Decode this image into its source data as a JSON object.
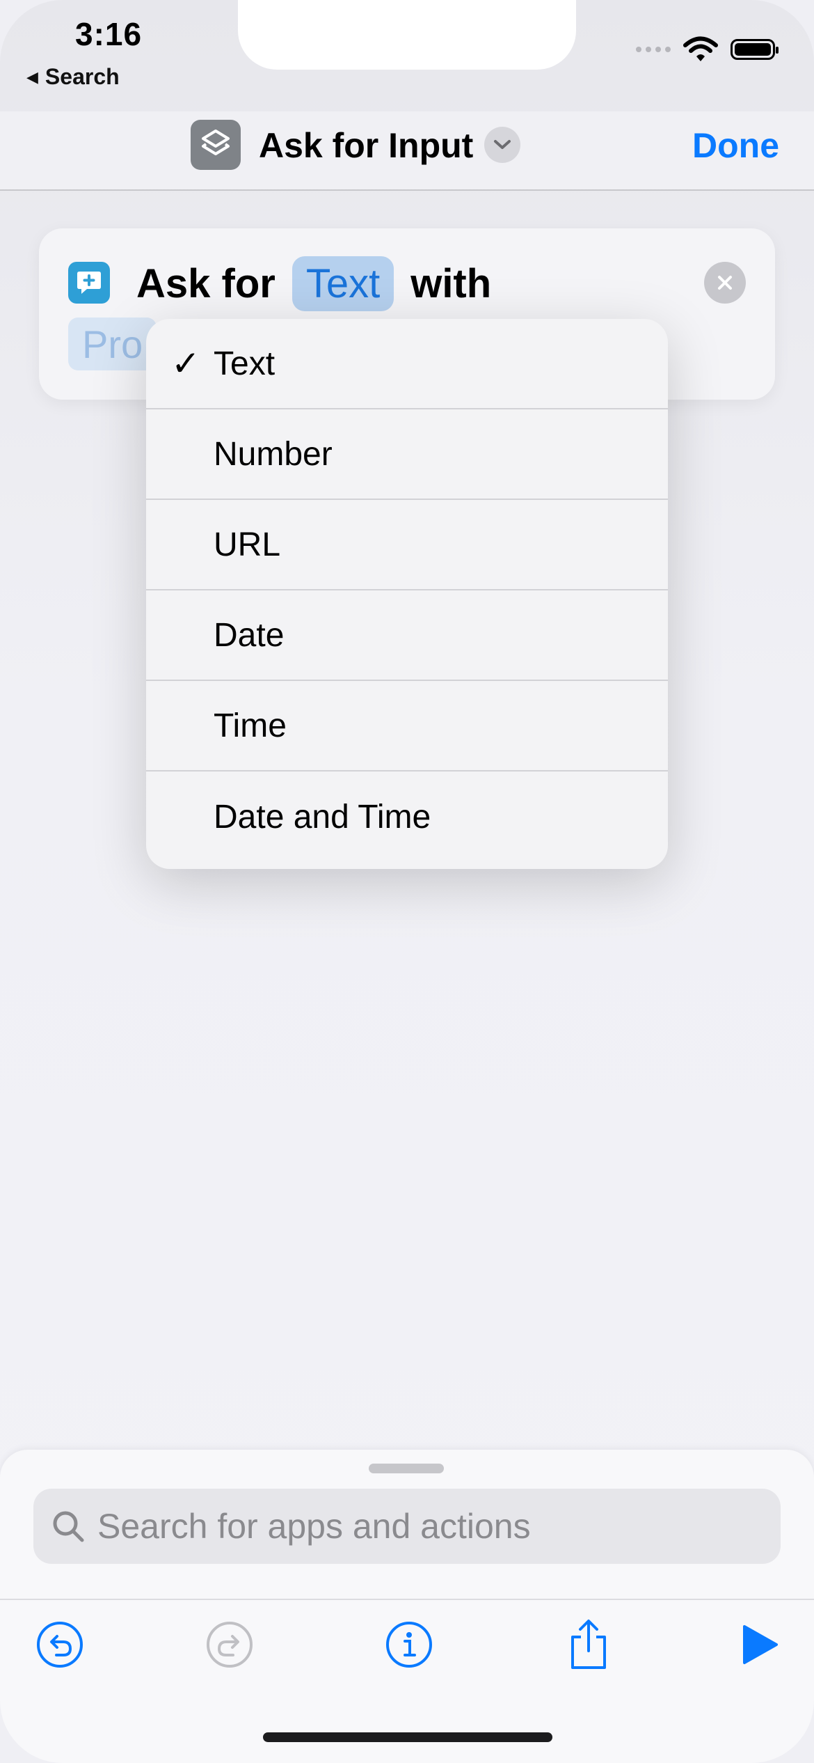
{
  "status_bar": {
    "time": "3:16",
    "back_app": "Search"
  },
  "navbar": {
    "title": "Ask for Input",
    "done_label": "Done"
  },
  "action_card": {
    "prefix": "Ask for",
    "type_token": "Text",
    "suffix": "with",
    "prompt_token": "Pro"
  },
  "menu": {
    "items": [
      {
        "label": "Text",
        "checked": true
      },
      {
        "label": "Number",
        "checked": false
      },
      {
        "label": "URL",
        "checked": false
      },
      {
        "label": "Date",
        "checked": false
      },
      {
        "label": "Time",
        "checked": false
      },
      {
        "label": "Date and Time",
        "checked": false
      }
    ],
    "check_glyph": "✓"
  },
  "bottom_sheet": {
    "search_placeholder": "Search for apps and actions",
    "toolbar": [
      "undo-icon",
      "redo-icon",
      "info-icon",
      "share-icon",
      "play-icon"
    ]
  },
  "colors": {
    "accent": "#0a7aff",
    "token_bg": "#b5d0ee",
    "disabled": "#c0c0c4"
  }
}
